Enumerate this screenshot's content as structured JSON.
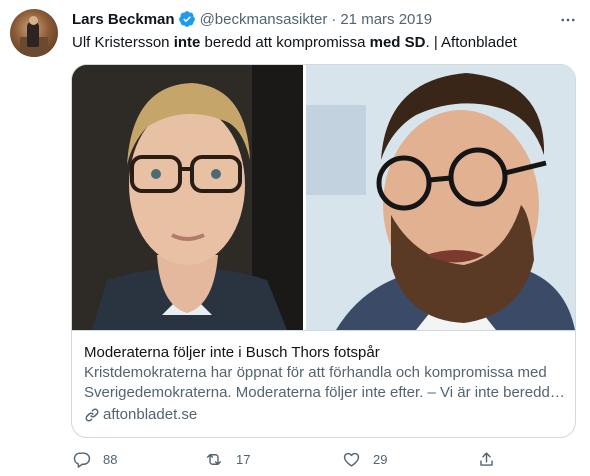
{
  "tweet": {
    "author_name": "Lars Beckman",
    "handle": "@beckmansasikter",
    "separator": "·",
    "date": "21 mars 2019",
    "text_parts": {
      "p1": "Ulf Kristersson ",
      "p2": "inte",
      "p3": " beredd att kompromissa ",
      "p4": "med SD",
      "p5": ". | Aftonbladet"
    }
  },
  "card": {
    "title": "Moderaterna följer inte i Busch Thors fotspår",
    "description_line1": "Kristdemokraterna har öppnat för att förhandla och kompromissa med",
    "description_line2": "Sverigedemokraterna. Moderaterna följer inte efter. – Vi är inte beredd…",
    "domain": "aftonbladet.se"
  },
  "actions": {
    "replies": "88",
    "retweets": "17",
    "likes": "29"
  },
  "icons": {
    "verified": "verified-badge-icon",
    "more": "more-options-icon",
    "link": "link-icon",
    "reply": "reply-icon",
    "retweet": "retweet-icon",
    "like": "heart-icon",
    "share": "share-icon"
  },
  "colors": {
    "verified_blue": "#1d9bf0",
    "text_primary": "#0f1419",
    "text_secondary": "#536471",
    "border": "#cfd9de"
  }
}
